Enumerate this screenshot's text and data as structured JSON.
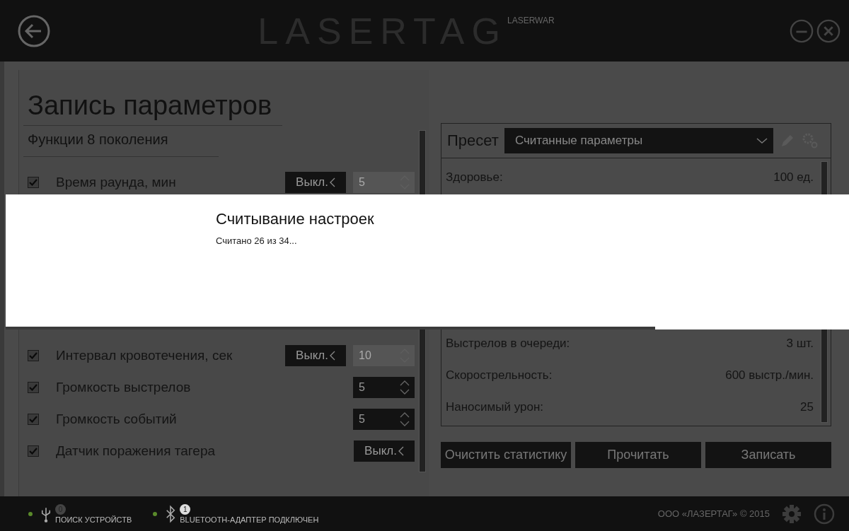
{
  "header": {
    "logo": "LASERTAG",
    "brand": "LASERWAR"
  },
  "page": {
    "title": "Запись параметров",
    "section": "Функции 8 поколения"
  },
  "params": [
    {
      "kind": "toggle_spinner",
      "label": "Время раунда, мин",
      "checked": true,
      "toggle": "Выкл.",
      "spinner": {
        "value": "5",
        "disabled": true
      }
    },
    {
      "kind": "gap"
    },
    {
      "kind": "toggle_spinner",
      "label": "Интервал кровотечения, сек",
      "checked": true,
      "toggle": "Выкл.",
      "spinner": {
        "value": "10",
        "disabled": true
      }
    },
    {
      "kind": "spinner",
      "label": "Громкость выстрелов",
      "checked": true,
      "spinner": {
        "value": "5",
        "disabled": false
      }
    },
    {
      "kind": "spinner",
      "label": "Громкость событий",
      "checked": true,
      "spinner": {
        "value": "5",
        "disabled": false
      }
    },
    {
      "kind": "toggle",
      "label": "Датчик поражения тагера",
      "checked": true,
      "toggle": "Выкл."
    }
  ],
  "preset": {
    "label": "Пресет",
    "value": "Считанные параметры"
  },
  "stats": [
    {
      "kind": "row",
      "label": "Здоровье:",
      "value": "100 ед."
    },
    {
      "kind": "gap"
    },
    {
      "kind": "row",
      "label": "Выстрелов в очереди:",
      "value": "3 шт."
    },
    {
      "kind": "row",
      "label": "Скорострельность:",
      "value": "600 выстр./мин."
    },
    {
      "kind": "row",
      "label": "Наносимый урон:",
      "value": "25"
    }
  ],
  "actions": [
    "Очистить статистику",
    "Прочитать",
    "Записать"
  ],
  "dialog": {
    "title": "Считывание настроек",
    "message": "Считано 26 из 34...",
    "level": 0.77
  },
  "status": [
    {
      "kind": "usb",
      "count": "0",
      "label": "ПОИСК УСТРОЙСТВ",
      "active": false
    },
    {
      "kind": "bluetooth",
      "count": "1",
      "label": "BLUETOOTH-АДАПТЕР ПОДКЛЮЧЕН",
      "active": true
    }
  ],
  "copyright": "ООО «ЛАЗЕРТАГ» © 2015"
}
